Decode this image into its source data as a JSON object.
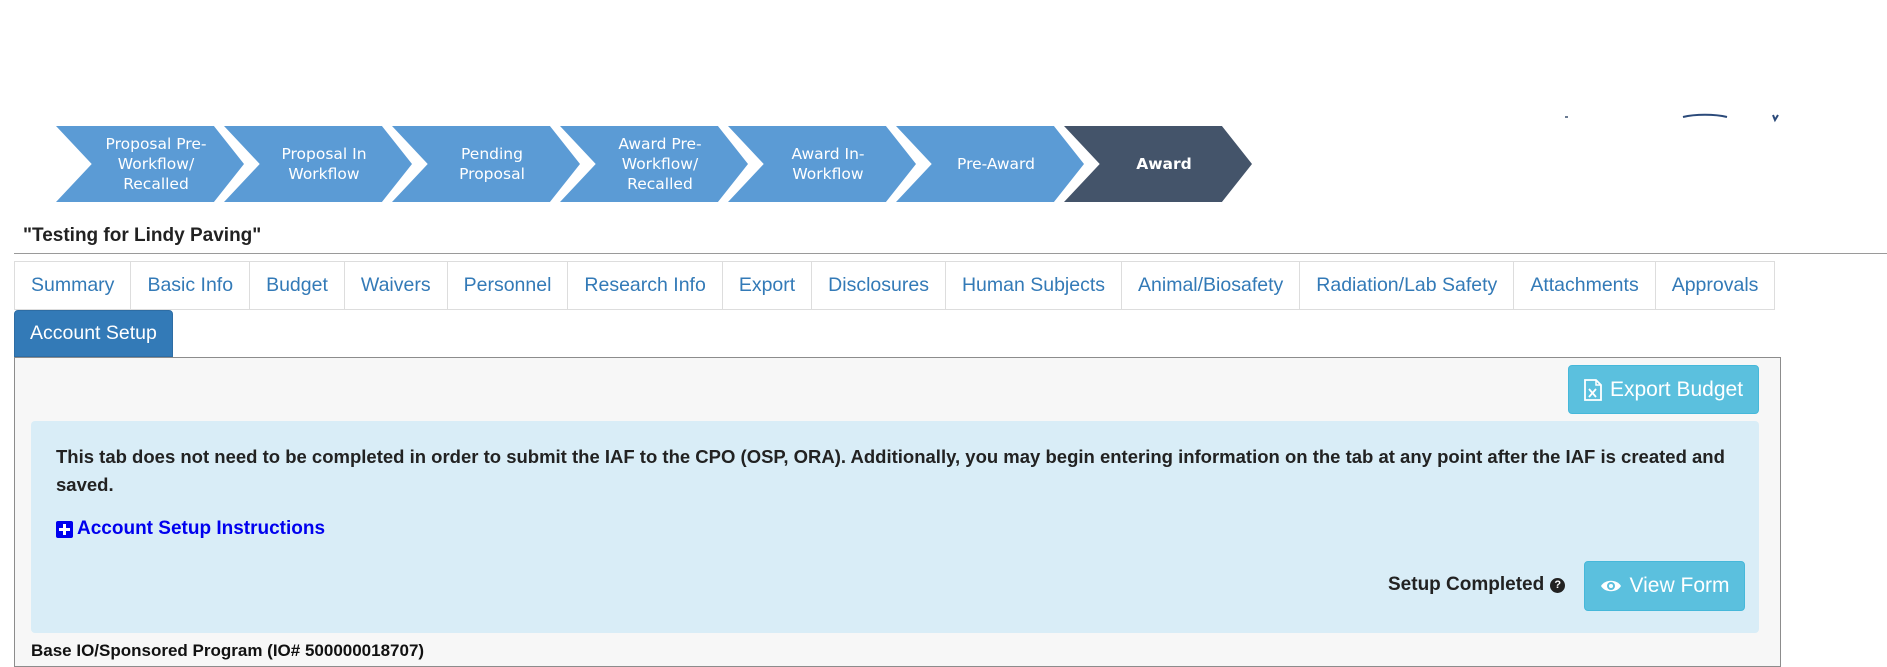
{
  "workflow": {
    "steps": [
      {
        "label": "Proposal Pre-\nWorkflow/\nRecalled"
      },
      {
        "label": "Proposal In\nWorkflow"
      },
      {
        "label": "Pending\nProposal"
      },
      {
        "label": "Award Pre-\nWorkflow/\nRecalled"
      },
      {
        "label": "Award In-\nWorkflow"
      },
      {
        "label": "Pre-Award"
      },
      {
        "label": "Award"
      }
    ],
    "active_color": "#44546a",
    "step_color": "#5b9bd5"
  },
  "record": {
    "title": "\"Testing for Lindy Paving\""
  },
  "tabs": {
    "items": [
      "Summary",
      "Basic Info",
      "Budget",
      "Waivers",
      "Personnel",
      "Research Info",
      "Export",
      "Disclosures",
      "Human Subjects",
      "Animal/Biosafety",
      "Radiation/Lab Safety",
      "Attachments",
      "Approvals"
    ],
    "active": "Account Setup"
  },
  "panel": {
    "export_button": "Export Budget",
    "info_text": "This tab does not need to be completed in order to submit the IAF to the CPO (OSP, ORA). Additionally, you may begin entering information on the tab at any point after the IAF is created and saved.",
    "instructions_link": "Account Setup Instructions",
    "setup_label": "Setup Completed",
    "view_button": "View Form",
    "base_io": "Base IO/Sponsored Program (IO# 500000018707)"
  },
  "colors": {
    "tab_text": "#337ab7",
    "info_bg": "#d9edf7",
    "button_info": "#5bc0de",
    "link": "#0000ee"
  }
}
